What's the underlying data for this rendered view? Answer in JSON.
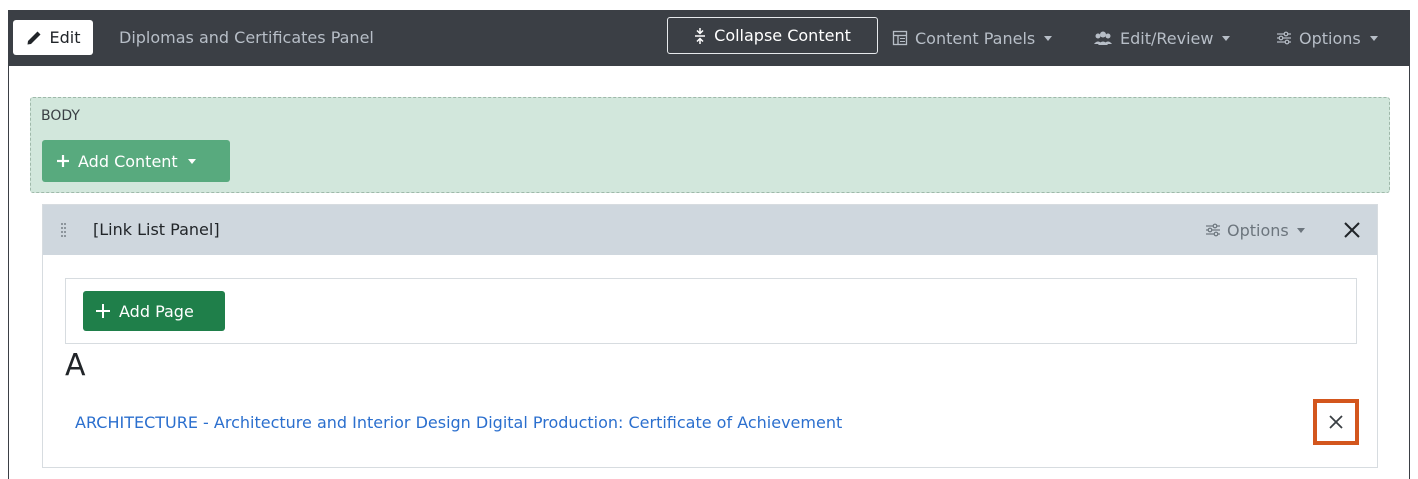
{
  "topbar": {
    "edit_label": "Edit",
    "panel_title": "Diplomas and Certificates Panel",
    "collapse_label": "Collapse Content",
    "content_panels_label": "Content Panels",
    "edit_review_label": "Edit/Review",
    "options_label": "Options"
  },
  "body_zone": {
    "label": "BODY",
    "add_content_label": "Add Content"
  },
  "panel": {
    "name": "[Link List Panel]",
    "options_label": "Options",
    "add_page_label": "Add Page",
    "section_letter": "A",
    "links": [
      {
        "text": "ARCHITECTURE - Architecture and Interior Design Digital Production: Certificate of Achievement"
      }
    ]
  },
  "colors": {
    "topbar_bg": "#3b3f45",
    "body_zone_bg": "#d2e7dc",
    "add_content_bg": "#58aa7e",
    "add_page_bg": "#1f7f4a",
    "link": "#2b6fce",
    "highlight": "#d3561d"
  },
  "icons": [
    "pencil-icon",
    "collapse-icon",
    "table-icon",
    "users-icon",
    "sliders-icon",
    "plus-icon",
    "drag-handle-icon",
    "close-icon",
    "caret-down-icon"
  ]
}
